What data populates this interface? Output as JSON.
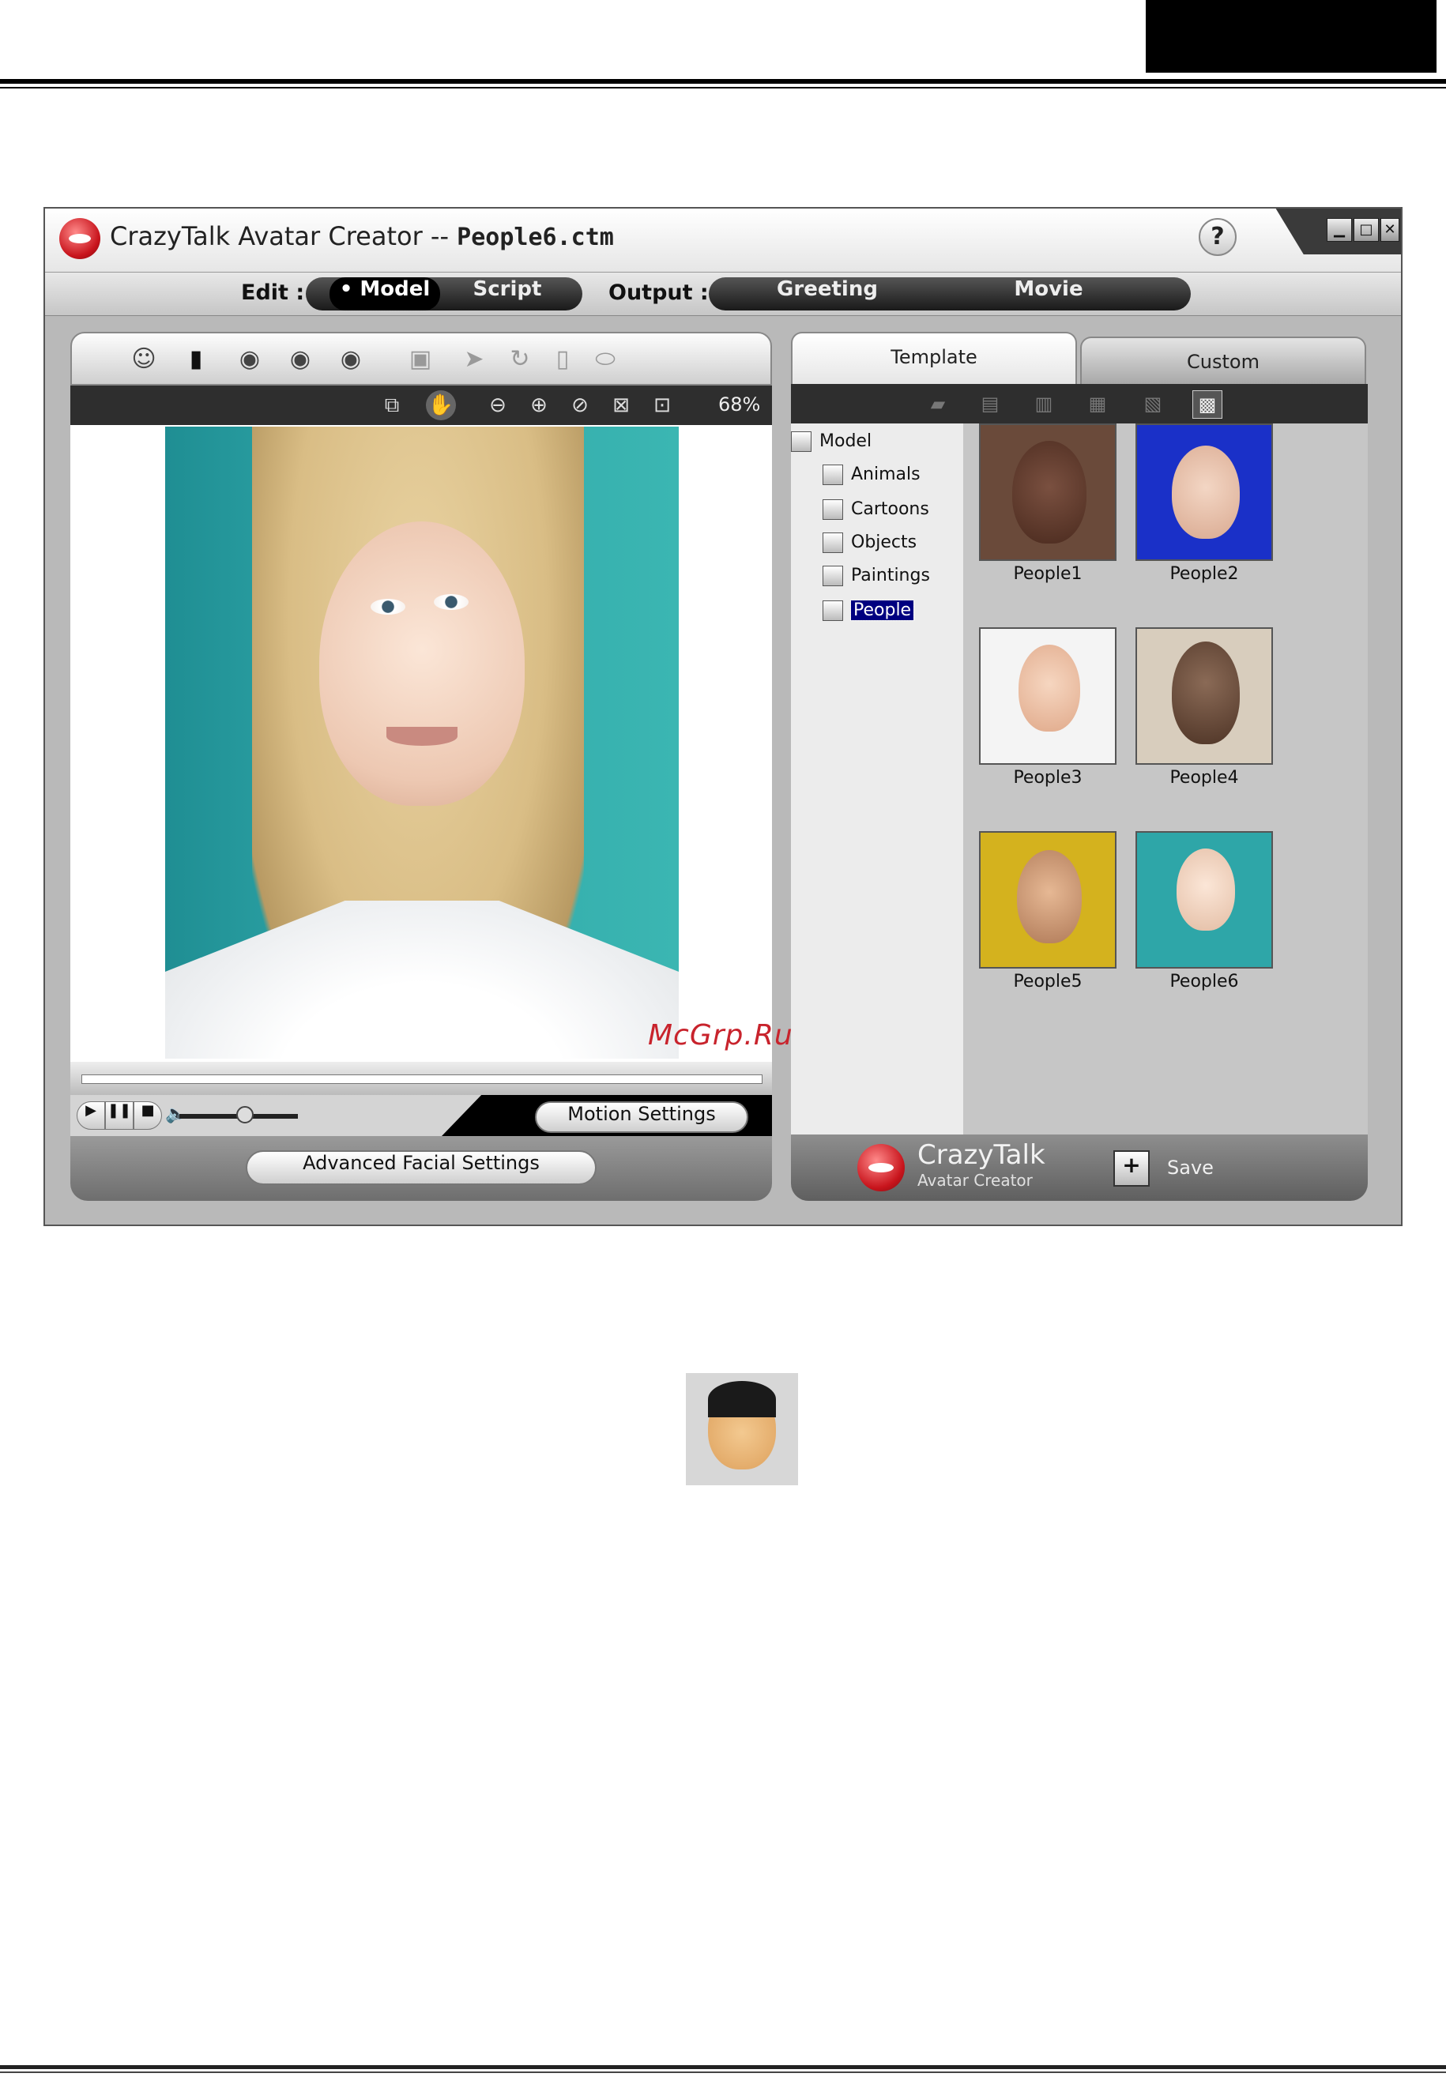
{
  "app": {
    "title_prefix": "CrazyTalk Avatar Creator -- ",
    "title_file": "People6.ctm",
    "help_label": "?",
    "window_controls": {
      "minimize": "▁",
      "maximize": "□",
      "close": "✕"
    }
  },
  "menubar": {
    "edit_label": "Edit :",
    "edit_items": [
      "Model",
      "Script"
    ],
    "edit_selected": "• Model",
    "output_label": "Output :",
    "output_items": [
      "Greeting",
      "Movie"
    ]
  },
  "left_panel": {
    "zoom": "68%",
    "motion_settings": "Motion Settings",
    "advanced_facial_settings": "Advanced Facial Settings",
    "tab_icons": [
      "face-icon",
      "mask-icon",
      "eye-open-icon",
      "eye-half-icon",
      "eye-lash-icon",
      "frame-icon",
      "pointer-icon",
      "rotate-icon",
      "page-icon",
      "lips-icon"
    ],
    "tool_icons": [
      "fit-icon",
      "hand-icon",
      "zoom-out-icon",
      "zoom-in-icon",
      "reset-icon",
      "full-icon",
      "target-icon"
    ]
  },
  "right_panel": {
    "tabs": {
      "template": "Template",
      "custom": "Custom"
    },
    "tree": {
      "root": "Model",
      "children": [
        "Animals",
        "Cartoons",
        "Objects",
        "Paintings",
        "People"
      ],
      "selected": "People"
    },
    "thumbnails": [
      "People1",
      "People2",
      "People3",
      "People4",
      "People5",
      "People6"
    ],
    "brand_title": "CrazyTalk",
    "brand_sub": "Avatar Creator",
    "save_label": "Save"
  },
  "page": {
    "watermark": "McGrp.Ru"
  },
  "colors": {
    "accent_red": "#c8141c",
    "selection": "#000080",
    "teal_bg": "#2ea6a8"
  }
}
